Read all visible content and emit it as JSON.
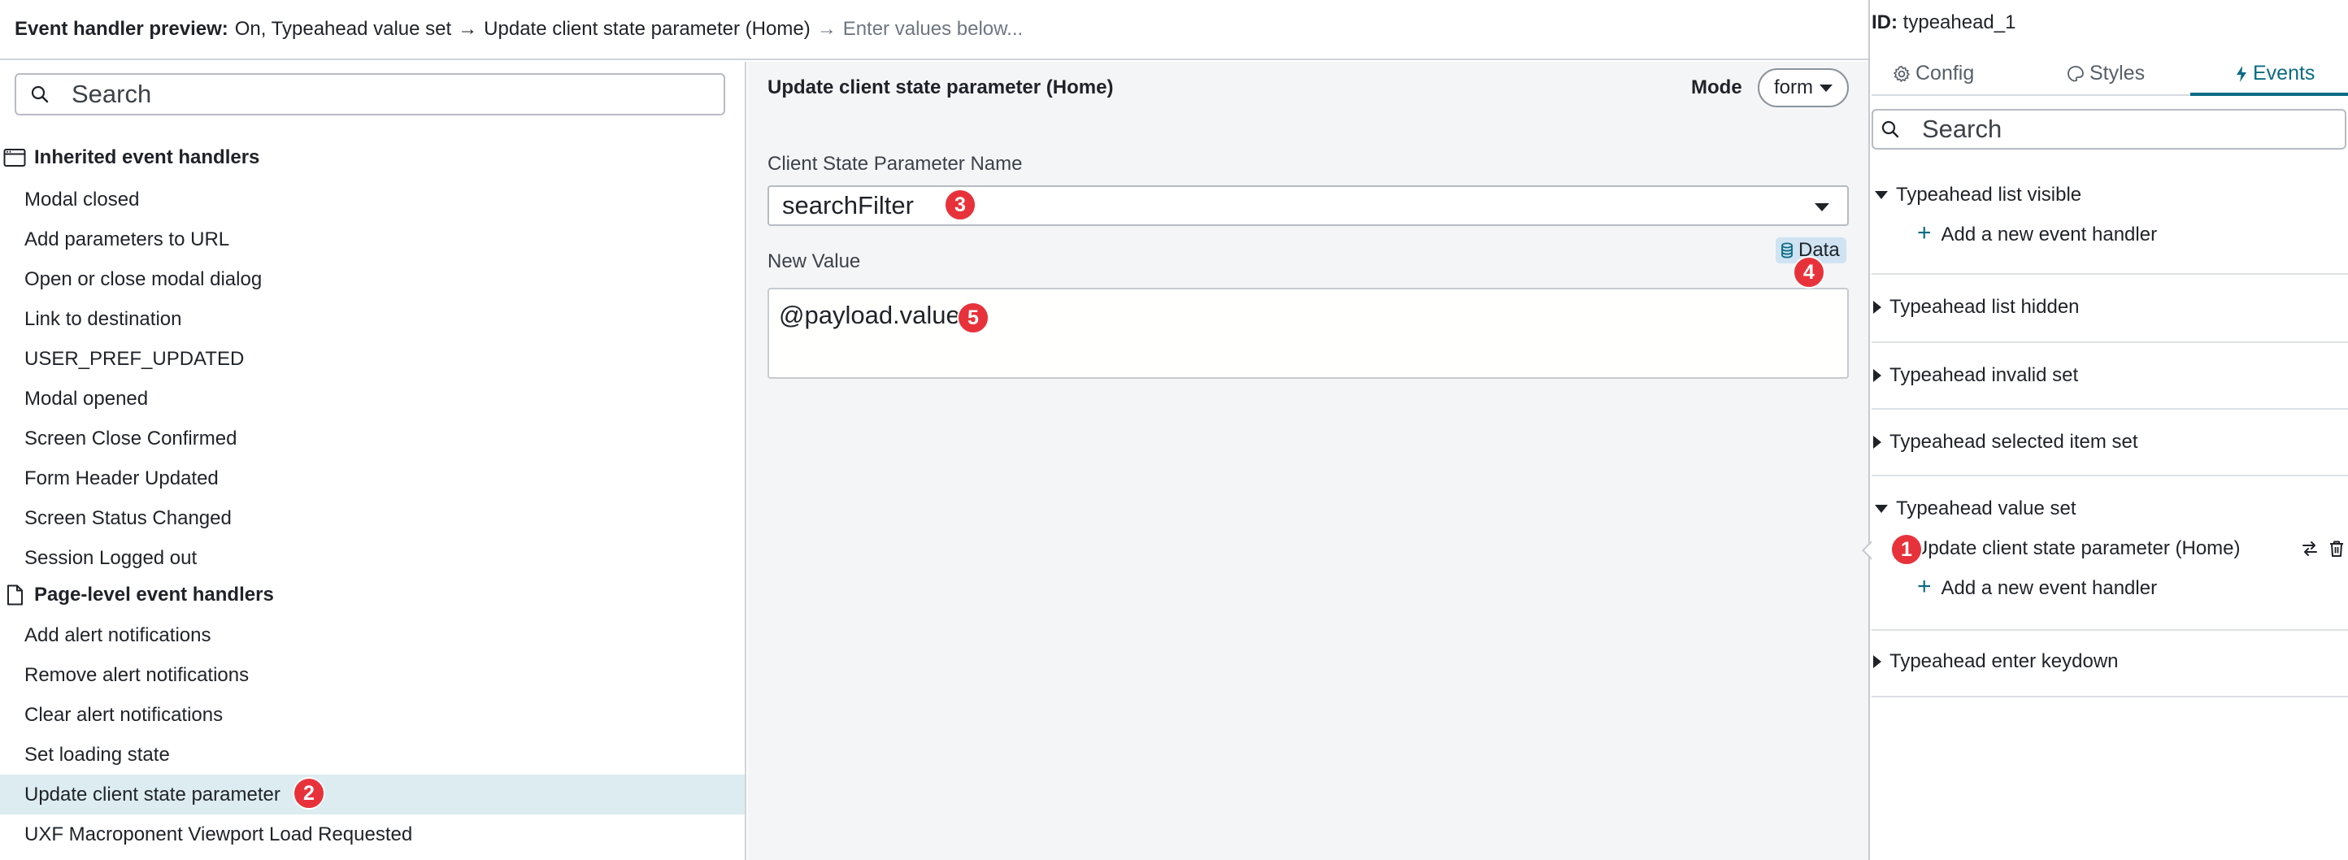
{
  "header": {
    "title": "Event handler preview:",
    "event_context": "On, Typeahead value set",
    "arrow": "→",
    "action": "Update client state parameter (Home)",
    "hint_arrow": "→",
    "hint": "Enter values below..."
  },
  "left_panel": {
    "search_placeholder": "Search",
    "inherited": {
      "heading": "Inherited event handlers",
      "items": [
        "Modal closed",
        "Add parameters to URL",
        "Open or close modal dialog",
        "Link to destination",
        "USER_PREF_UPDATED",
        "Modal opened",
        "Screen Close Confirmed",
        "Form Header Updated",
        "Screen Status Changed",
        "Session Logged out"
      ]
    },
    "page_level": {
      "heading": "Page-level event handlers",
      "items": [
        "Add alert notifications",
        "Remove alert notifications",
        "Clear alert notifications",
        "Set loading state",
        "Update client state parameter",
        "UXF Macroponent Viewport Load Requested"
      ],
      "selected_item": "Update client state parameter"
    }
  },
  "form": {
    "title": "Update client state parameter (Home)",
    "mode_label": "Mode",
    "mode_value": "form",
    "param_name_label": "Client State Parameter Name",
    "param_name_value": "searchFilter",
    "new_value_label": "New Value",
    "data_pill": "Data",
    "new_value": "@payload.value"
  },
  "inspector": {
    "id_key": "ID:",
    "id_value": "typeahead_1",
    "tabs": [
      "Config",
      "Styles",
      "Events"
    ],
    "active_tab": "Events",
    "search_placeholder": "Search",
    "events": {
      "list_visible": "Typeahead list visible",
      "list_hidden": "Typeahead list hidden",
      "invalid_set": "Typeahead invalid set",
      "selected_item_set": "Typeahead selected item set",
      "value_set": "Typeahead value set",
      "enter_keydown": "Typeahead enter keydown"
    },
    "add_handler_label": "Add a new event handler",
    "value_set_handler": "Update client state parameter (Home)"
  },
  "markers": [
    "1",
    "2",
    "3",
    "4",
    "5"
  ],
  "colors": {
    "accent": "#0b6b83",
    "selected_row": "#dcecf0",
    "marker": "#e8323b",
    "data_pill": "#cfe3f2"
  }
}
